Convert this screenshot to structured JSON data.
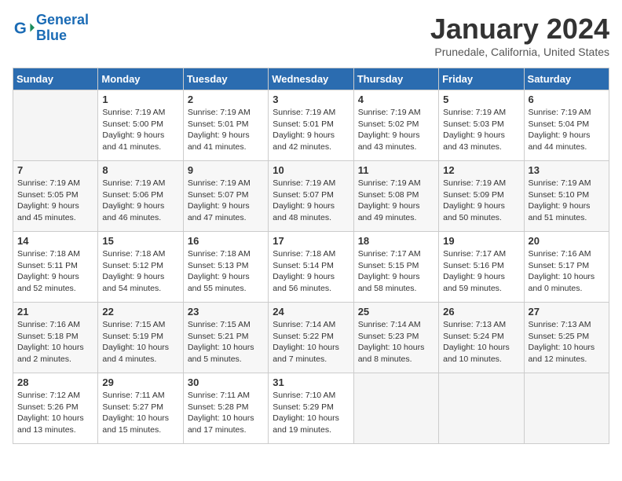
{
  "header": {
    "logo_line1": "General",
    "logo_line2": "Blue",
    "month": "January 2024",
    "location": "Prunedale, California, United States"
  },
  "weekdays": [
    "Sunday",
    "Monday",
    "Tuesday",
    "Wednesday",
    "Thursday",
    "Friday",
    "Saturday"
  ],
  "weeks": [
    [
      {
        "day": "",
        "empty": true
      },
      {
        "day": "1",
        "sunrise": "7:19 AM",
        "sunset": "5:00 PM",
        "daylight": "9 hours and 41 minutes."
      },
      {
        "day": "2",
        "sunrise": "7:19 AM",
        "sunset": "5:01 PM",
        "daylight": "9 hours and 41 minutes."
      },
      {
        "day": "3",
        "sunrise": "7:19 AM",
        "sunset": "5:01 PM",
        "daylight": "9 hours and 42 minutes."
      },
      {
        "day": "4",
        "sunrise": "7:19 AM",
        "sunset": "5:02 PM",
        "daylight": "9 hours and 43 minutes."
      },
      {
        "day": "5",
        "sunrise": "7:19 AM",
        "sunset": "5:03 PM",
        "daylight": "9 hours and 43 minutes."
      },
      {
        "day": "6",
        "sunrise": "7:19 AM",
        "sunset": "5:04 PM",
        "daylight": "9 hours and 44 minutes."
      }
    ],
    [
      {
        "day": "7",
        "sunrise": "7:19 AM",
        "sunset": "5:05 PM",
        "daylight": "9 hours and 45 minutes."
      },
      {
        "day": "8",
        "sunrise": "7:19 AM",
        "sunset": "5:06 PM",
        "daylight": "9 hours and 46 minutes."
      },
      {
        "day": "9",
        "sunrise": "7:19 AM",
        "sunset": "5:07 PM",
        "daylight": "9 hours and 47 minutes."
      },
      {
        "day": "10",
        "sunrise": "7:19 AM",
        "sunset": "5:07 PM",
        "daylight": "9 hours and 48 minutes."
      },
      {
        "day": "11",
        "sunrise": "7:19 AM",
        "sunset": "5:08 PM",
        "daylight": "9 hours and 49 minutes."
      },
      {
        "day": "12",
        "sunrise": "7:19 AM",
        "sunset": "5:09 PM",
        "daylight": "9 hours and 50 minutes."
      },
      {
        "day": "13",
        "sunrise": "7:19 AM",
        "sunset": "5:10 PM",
        "daylight": "9 hours and 51 minutes."
      }
    ],
    [
      {
        "day": "14",
        "sunrise": "7:18 AM",
        "sunset": "5:11 PM",
        "daylight": "9 hours and 52 minutes."
      },
      {
        "day": "15",
        "sunrise": "7:18 AM",
        "sunset": "5:12 PM",
        "daylight": "9 hours and 54 minutes."
      },
      {
        "day": "16",
        "sunrise": "7:18 AM",
        "sunset": "5:13 PM",
        "daylight": "9 hours and 55 minutes."
      },
      {
        "day": "17",
        "sunrise": "7:18 AM",
        "sunset": "5:14 PM",
        "daylight": "9 hours and 56 minutes."
      },
      {
        "day": "18",
        "sunrise": "7:17 AM",
        "sunset": "5:15 PM",
        "daylight": "9 hours and 58 minutes."
      },
      {
        "day": "19",
        "sunrise": "7:17 AM",
        "sunset": "5:16 PM",
        "daylight": "9 hours and 59 minutes."
      },
      {
        "day": "20",
        "sunrise": "7:16 AM",
        "sunset": "5:17 PM",
        "daylight": "10 hours and 0 minutes."
      }
    ],
    [
      {
        "day": "21",
        "sunrise": "7:16 AM",
        "sunset": "5:18 PM",
        "daylight": "10 hours and 2 minutes."
      },
      {
        "day": "22",
        "sunrise": "7:15 AM",
        "sunset": "5:19 PM",
        "daylight": "10 hours and 4 minutes."
      },
      {
        "day": "23",
        "sunrise": "7:15 AM",
        "sunset": "5:21 PM",
        "daylight": "10 hours and 5 minutes."
      },
      {
        "day": "24",
        "sunrise": "7:14 AM",
        "sunset": "5:22 PM",
        "daylight": "10 hours and 7 minutes."
      },
      {
        "day": "25",
        "sunrise": "7:14 AM",
        "sunset": "5:23 PM",
        "daylight": "10 hours and 8 minutes."
      },
      {
        "day": "26",
        "sunrise": "7:13 AM",
        "sunset": "5:24 PM",
        "daylight": "10 hours and 10 minutes."
      },
      {
        "day": "27",
        "sunrise": "7:13 AM",
        "sunset": "5:25 PM",
        "daylight": "10 hours and 12 minutes."
      }
    ],
    [
      {
        "day": "28",
        "sunrise": "7:12 AM",
        "sunset": "5:26 PM",
        "daylight": "10 hours and 13 minutes."
      },
      {
        "day": "29",
        "sunrise": "7:11 AM",
        "sunset": "5:27 PM",
        "daylight": "10 hours and 15 minutes."
      },
      {
        "day": "30",
        "sunrise": "7:11 AM",
        "sunset": "5:28 PM",
        "daylight": "10 hours and 17 minutes."
      },
      {
        "day": "31",
        "sunrise": "7:10 AM",
        "sunset": "5:29 PM",
        "daylight": "10 hours and 19 minutes."
      },
      {
        "day": "",
        "empty": true
      },
      {
        "day": "",
        "empty": true
      },
      {
        "day": "",
        "empty": true
      }
    ]
  ],
  "labels": {
    "sunrise": "Sunrise:",
    "sunset": "Sunset:",
    "daylight": "Daylight:"
  }
}
